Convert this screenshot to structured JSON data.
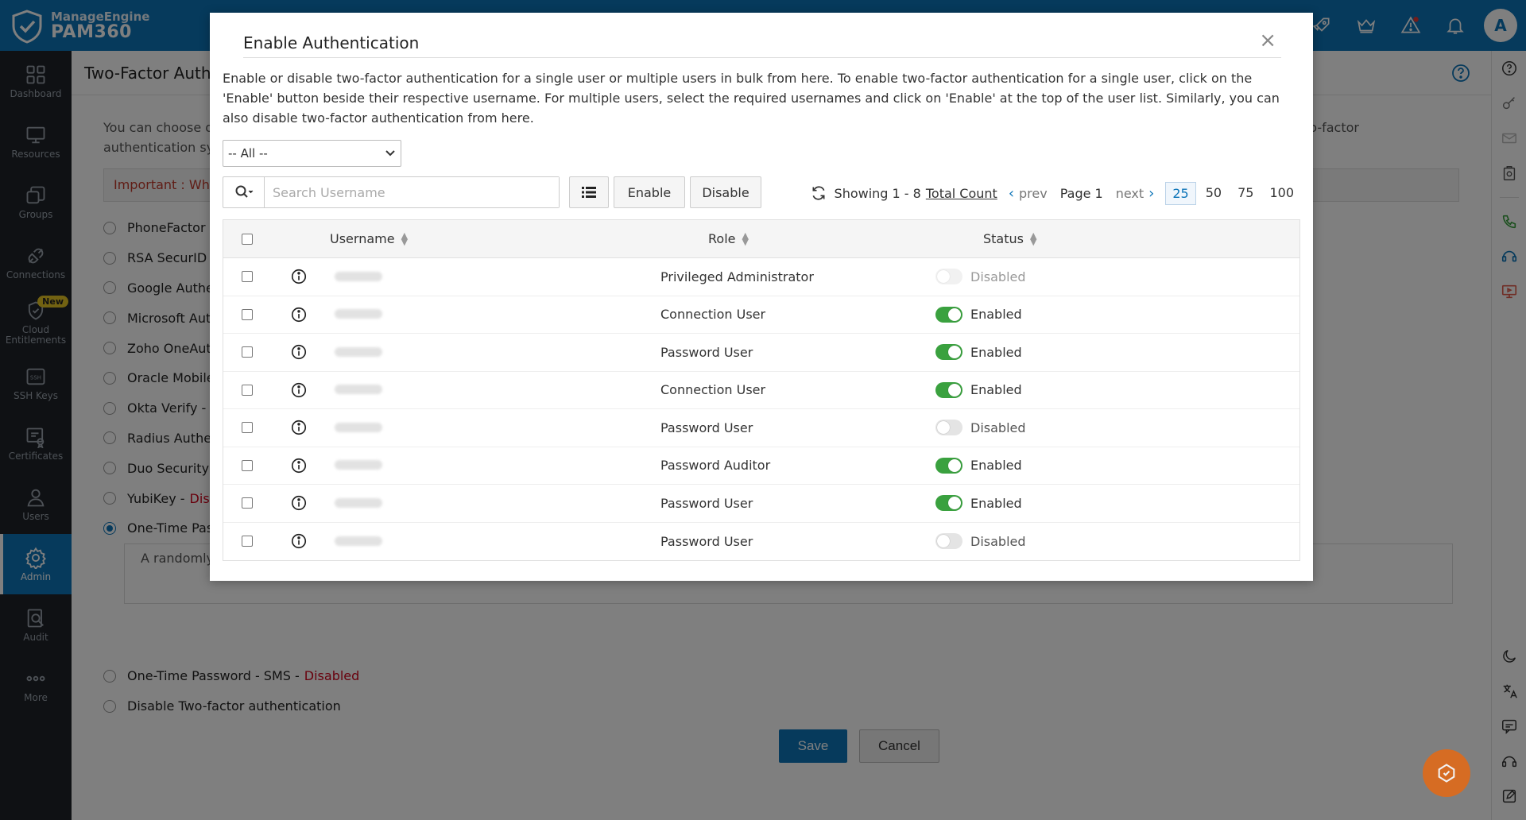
{
  "brand": {
    "company": "ManageEngine",
    "product": "PAM360"
  },
  "user": {
    "avatar_letter": "A"
  },
  "nav": [
    {
      "label": "Dashboard",
      "icon": "dashboard-icon"
    },
    {
      "label": "Resources",
      "icon": "monitor-icon"
    },
    {
      "label": "Groups",
      "icon": "groups-icon"
    },
    {
      "label": "Connections",
      "icon": "connections-icon"
    },
    {
      "label": "Cloud Entitlements",
      "icon": "cloud-entitlements-icon",
      "badge": "New"
    },
    {
      "label": "SSH Keys",
      "icon": "ssh-key-icon"
    },
    {
      "label": "Certificates",
      "icon": "certificate-icon"
    },
    {
      "label": "Users",
      "icon": "user-icon"
    },
    {
      "label": "Admin",
      "icon": "gear-icon",
      "active": true
    },
    {
      "label": "Audit",
      "icon": "audit-icon"
    },
    {
      "label": "More",
      "icon": "more-icon"
    }
  ],
  "page": {
    "title": "Two-Factor Authe",
    "intro_line1_left": "You can choose o",
    "intro_line1_right": "Two-factor",
    "intro_line2_left": "authentication sys",
    "important_label": "Important : Whe",
    "methods": [
      {
        "label": "PhoneFactor  -"
      },
      {
        "label": "RSA SecurID  -"
      },
      {
        "label": "Google Authe"
      },
      {
        "label": "Microsoft Auth"
      },
      {
        "label": "Zoho OneAuth"
      },
      {
        "label": "Oracle Mobile"
      },
      {
        "label": "Okta Verify  -"
      },
      {
        "label": "Radius Auther"
      },
      {
        "label": "Duo Security  -"
      },
      {
        "label": "YubiKey  -",
        "status": "Disa"
      },
      {
        "label": "One-Time Pas",
        "checked": true
      }
    ],
    "otp_description": "A randomly",
    "methods_bottom": [
      {
        "label": "One-Time Password - SMS  -",
        "status": "Disabled"
      },
      {
        "label": "Disable Two-factor authentication"
      }
    ],
    "save_label": "Save",
    "cancel_label": "Cancel"
  },
  "modal": {
    "title": "Enable Authentication",
    "close_glyph": "×",
    "description": "Enable or disable two-factor authentication for a single user or multiple users in bulk from here. To enable two-factor authentication for a single user, click on the 'Enable' button beside their respective username. For multiple users, select the required usernames and click on 'Enable' at the top of the user list. Similarly, you can also disable two-factor authentication from here.",
    "filter_selected": "-- All --",
    "search_placeholder": "Search Username",
    "enable_label": "Enable",
    "disable_label": "Disable",
    "paging": {
      "showing": "Showing 1 - 8",
      "total_count": "Total Count",
      "prev": "prev",
      "page": "Page 1",
      "next": "next",
      "sizes": [
        "25",
        "50",
        "75",
        "100"
      ],
      "active_size": "25"
    },
    "columns": {
      "username": "Username",
      "role": "Role",
      "status": "Status"
    },
    "rows": [
      {
        "role": "Privileged Administrator",
        "status": "Disabled",
        "enabled": false,
        "faded": true
      },
      {
        "role": "Connection User",
        "status": "Enabled",
        "enabled": true
      },
      {
        "role": "Password User",
        "status": "Enabled",
        "enabled": true
      },
      {
        "role": "Connection User",
        "status": "Enabled",
        "enabled": true
      },
      {
        "role": "Password User",
        "status": "Disabled",
        "enabled": false
      },
      {
        "role": "Password Auditor",
        "status": "Enabled",
        "enabled": true
      },
      {
        "role": "Password User",
        "status": "Enabled",
        "enabled": true
      },
      {
        "role": "Password User",
        "status": "Disabled",
        "enabled": false
      }
    ]
  },
  "colors": {
    "brand_blue": "#0c74b8",
    "nav_dark": "#1e2329",
    "enabled_green": "#3aa13f",
    "disabled_red": "#d0021b"
  }
}
